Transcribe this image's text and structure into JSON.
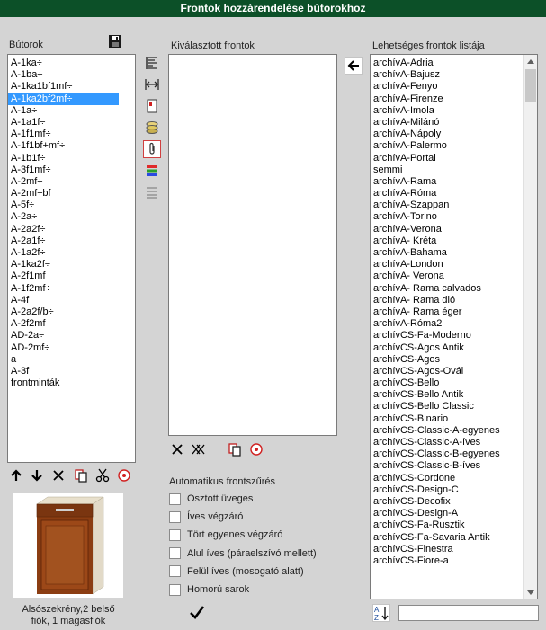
{
  "window": {
    "title": "Frontok hozzárendelése bútorokhoz"
  },
  "left": {
    "label": "Bútorok",
    "items": [
      "A-1ka÷",
      "A-1ba÷",
      "A-1ka1bf1mf÷",
      "A-1ka2bf2mf÷",
      "A-1a÷",
      "A-1a1f÷",
      "A-1f1mf÷",
      "A-1f1bf+mf÷",
      "A-1b1f÷",
      "A-3f1mf÷",
      "A-2mf÷",
      "A-2mf÷bf",
      "A-5f÷",
      "A-2a÷",
      "A-2a2f÷",
      "A-2a1f÷",
      "A-1a2f÷",
      "A-1ka2f÷",
      "A-2f1mf",
      "A-1f2mf÷",
      "A-4f",
      "A-2a2f/b÷",
      "A-2f2mf",
      "AD-2a÷",
      "AD-2mf÷",
      "a",
      "A-3f",
      "frontminták"
    ],
    "selected_index": 3,
    "preview_caption": "Alsószekrény,2 belső fiók, 1 magasfiók"
  },
  "middle": {
    "label": "Kiválasztott frontok",
    "auto_filter_label": "Automatikus frontszűrés",
    "checkboxes": [
      "Osztott üveges",
      "Íves végzáró",
      "Tört egyenes végzáró",
      "Alul íves (páraelszívó mellett)",
      "Felül íves (mosogató alatt)",
      "Homorú sarok"
    ]
  },
  "right": {
    "label": "Lehetséges frontok listája",
    "items": [
      "archívA-Adria",
      "archívA-Bajusz",
      "archívA-Fenyo",
      "archívA-Firenze",
      "archívA-Imola",
      "archívA-Milánó",
      "archívA-Nápoly",
      "archívA-Palermo",
      "archívA-Portal",
      "semmi",
      "archívA-Rama",
      "archívA-Róma",
      "archívA-Szappan",
      "archívA-Torino",
      "archívA-Verona",
      "archívA- Kréta",
      "archívA-Bahama",
      "archívA-London",
      "archívA- Verona",
      "archívA- Rama calvados",
      "archívA- Rama dió",
      "archívA- Rama éger",
      "archívA-Róma2",
      "archívCS-Fa-Moderno",
      "archívCS-Agos Antik",
      "archívCS-Agos",
      "archívCS-Agos-Ovál",
      "archívCS-Bello",
      "archívCS-Bello Antik",
      "archívCS-Bello Classic",
      "archívCS-Binario",
      "archívCS-Classic-A-egyenes",
      "archívCS-Classic-A-íves",
      "archívCS-Classic-B-egyenes",
      "archívCS-Classic-B-íves",
      "archívCS-Cordone",
      "archívCS-Design-C",
      "archívCS-Decofix",
      "archívCS-Design-A",
      "archívCS-Fa-Rusztik",
      "archívCS-Fa-Savaria Antik",
      "archívCS-Finestra",
      "archívCS-Fiore-a"
    ],
    "search_value": ""
  },
  "icons": {
    "save": "floppy-disk-icon",
    "tools": [
      "align-left-icon",
      "fit-width-icon",
      "door-red-handle-icon",
      "layers-stack-icon",
      "clip-icon",
      "color-stripes-icon",
      "list-icon"
    ],
    "left_bottom": [
      "arrow-up-icon",
      "arrow-down-icon",
      "delete-x-icon",
      "copy-red-icon",
      "scissors-icon",
      "target-icon"
    ],
    "mid_bottom": [
      "delete-x-icon",
      "delete-all-x-icon",
      "copy-red-icon",
      "target-icon"
    ],
    "add_arrow": "arrow-left-icon",
    "ok": "checkmark-icon",
    "sort": "sort-az-icon"
  }
}
